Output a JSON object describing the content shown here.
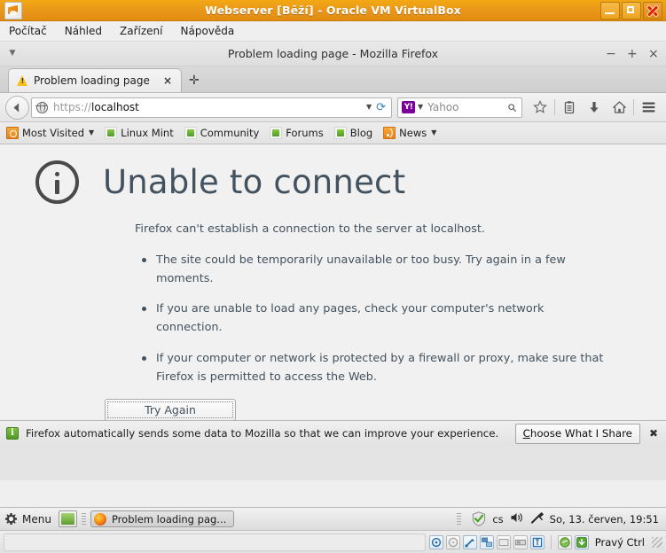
{
  "virtualbox": {
    "app_icon": "virtualbox-icon",
    "title": "Webserver [Běží] - Oracle VM VirtualBox",
    "window_buttons": {
      "minimize": "minimize-button",
      "maximize": "maximize-button",
      "close": "close-button"
    },
    "menu": [
      "Počítač",
      "Náhled",
      "Zařízení",
      "Nápověda"
    ],
    "status": {
      "icons": [
        "hard-disk-icon",
        "optical-disk-icon",
        "usb-icon",
        "network-icon",
        "shared-folders-icon",
        "display-icon",
        "vrdp-icon"
      ],
      "right_icons": [
        "mouse-integration-icon",
        "host-key-icon"
      ],
      "host_key_label": "Pravý Ctrl"
    }
  },
  "firefox": {
    "title": "Problem loading page - Mozilla Firefox",
    "caret_icon": "chevron-down-icon",
    "window_buttons": {
      "minimize": "−",
      "maximize": "+",
      "close": "×"
    },
    "tab": {
      "icon": "warning-icon",
      "label": "Problem loading page",
      "close": "×"
    },
    "new_tab_label": "✛",
    "navbar": {
      "back_icon": "back-arrow-icon",
      "url_scheme": "https://",
      "url_host": "localhost",
      "url_full": "https://localhost",
      "url_dropdown_icon": "chevron-down-icon",
      "reload_icon": "reload-icon",
      "identity_icon": "globe-icon",
      "search_engine_icon": "yahoo-icon",
      "search_engine_icon_text": "Y!",
      "search_placeholder": "Yahoo",
      "search_dropdown_icon": "chevron-down-icon",
      "search_go_icon": "magnifier-icon",
      "icons": [
        "bookmark-star-icon",
        "library-icon",
        "downloads-icon",
        "home-icon",
        "hamburger-menu-icon"
      ]
    },
    "bookmarks": [
      {
        "label": "Most Visited",
        "icon": "most-visited-icon",
        "has_caret": true
      },
      {
        "label": "Linux Mint",
        "icon": "mint-icon",
        "has_caret": false
      },
      {
        "label": "Community",
        "icon": "mint-icon",
        "has_caret": false
      },
      {
        "label": "Forums",
        "icon": "mint-icon",
        "has_caret": false
      },
      {
        "label": "Blog",
        "icon": "mint-icon",
        "has_caret": false
      },
      {
        "label": "News",
        "icon": "rss-icon",
        "has_caret": true
      }
    ],
    "error_page": {
      "icon": "info-circle-icon",
      "title": "Unable to connect",
      "lead": "Firefox can't establish a connection to the server at localhost.",
      "bullets": [
        "The site could be temporarily unavailable or too busy. Try again in a few moments.",
        "If you are unable to load any pages, check your computer's network connection.",
        "If your computer or network is protected by a firewall or proxy, make sure that Firefox is permitted to access the Web."
      ],
      "retry_button": "Try Again"
    },
    "notification": {
      "icon": "info-icon",
      "text": "Firefox automatically sends some data to Mozilla so that we can improve your experience.",
      "button_accesskey": "C",
      "button_rest": "hoose What I Share",
      "close": "✖"
    }
  },
  "taskbar": {
    "menu_icon": "gear-icon",
    "menu_label": "Menu",
    "show_desktop_icon": "show-desktop-icon",
    "task": {
      "icon": "firefox-icon",
      "label": "Problem loading pag..."
    },
    "tray": {
      "shield_icon": "update-shield-icon",
      "language": "cs",
      "volume_icon": "volume-icon",
      "bluetooth_icon": "bluetooth-icon",
      "clock": "So, 13. červen, 19:51"
    }
  },
  "colors": {
    "vb_titlebar": "#e8951a",
    "error_text": "#43525f",
    "tab_warning": "#f4c01a",
    "mint_green": "#5e9c2f",
    "yahoo_purple": "#7b0099"
  }
}
